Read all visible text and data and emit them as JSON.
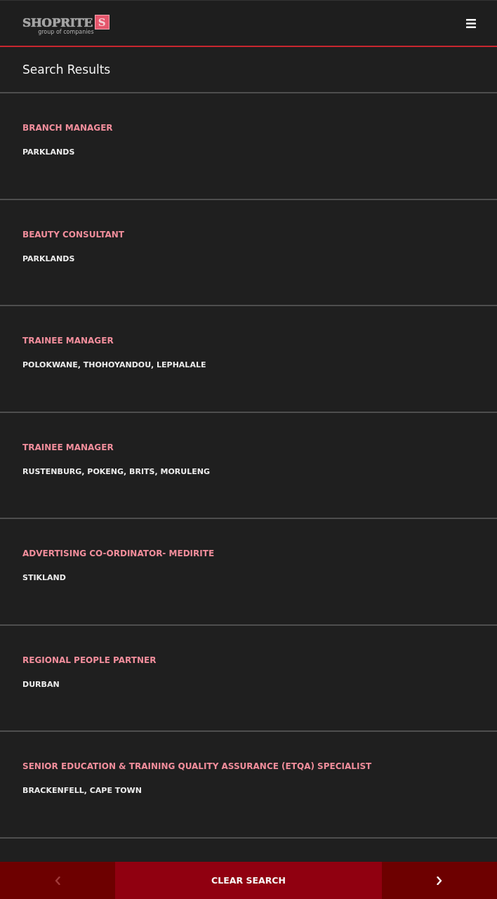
{
  "header": {
    "logo": {
      "wordmark": "SHOPRITE",
      "mark": "S",
      "tagline": "group of companies"
    }
  },
  "page_title": "Search Results",
  "results": [
    {
      "title": "BRANCH MANAGER",
      "location": "PARKLANDS"
    },
    {
      "title": "BEAUTY CONSULTANT",
      "location": "PARKLANDS"
    },
    {
      "title": "TRAINEE MANAGER",
      "location": "POLOKWANE, THOHOYANDOU, LEPHALALE"
    },
    {
      "title": "TRAINEE MANAGER",
      "location": "RUSTENBURG, POKENG, BRITS, MORULENG"
    },
    {
      "title": "ADVERTISING CO-ORDINATOR- MEDIRITE",
      "location": "STIKLAND"
    },
    {
      "title": "REGIONAL PEOPLE PARTNER",
      "location": "DURBAN"
    },
    {
      "title": "SENIOR EDUCATION & TRAINING QUALITY ASSURANCE (ETQA) SPECIALIST",
      "location": "BRACKENFELL, CAPE TOWN"
    }
  ],
  "pager": {
    "previous": {
      "disabled": true
    },
    "clear_label": "CLEAR SEARCH",
    "next": {
      "disabled": false
    }
  }
}
